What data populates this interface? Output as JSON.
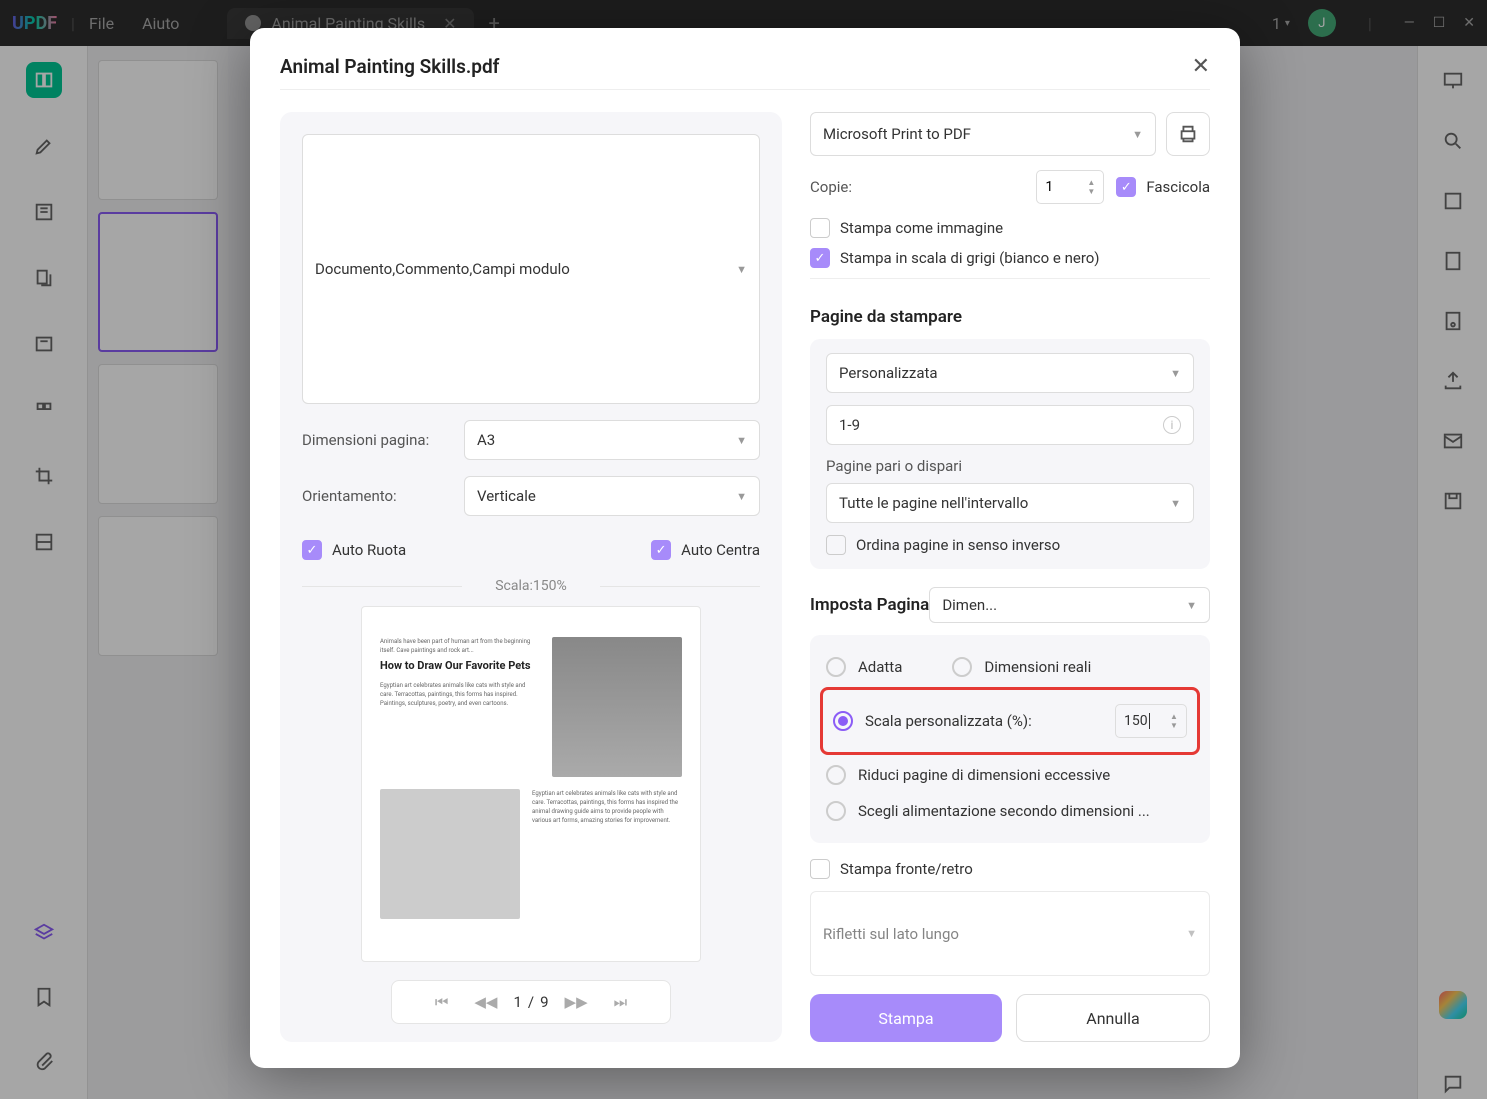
{
  "app": {
    "logo": "UPDF",
    "menus": [
      "File",
      "Aiuto"
    ],
    "tab_title": "Animal Painting Skills",
    "tab_count": "1",
    "avatar_letter": "J"
  },
  "dialog": {
    "title": "Animal Painting Skills.pdf",
    "content_type": "Documento,Commento,Campi modulo",
    "page_size_label": "Dimensioni pagina:",
    "page_size": "A3",
    "orientation_label": "Orientamento:",
    "orientation": "Verticale",
    "auto_rotate": "Auto Ruota",
    "auto_center": "Auto Centra",
    "scale_text": "Scala:150%",
    "preview_title": "How to Draw Our Favorite Pets",
    "pager": {
      "current": "1",
      "sep": "/",
      "total": "9"
    },
    "printer": "Microsoft Print to PDF",
    "copies_label": "Copie:",
    "copies": "1",
    "collate": "Fascicola",
    "print_as_image": "Stampa come immagine",
    "grayscale": "Stampa in scala di grigi (bianco e nero)",
    "pages_section": "Pagine da stampare",
    "range_mode": "Personalizzata",
    "range_value": "1-9",
    "odd_even_label": "Pagine pari o dispari",
    "odd_even": "Tutte le pagine nell'intervallo",
    "reverse": "Ordina pagine in senso inverso",
    "page_setup": "Imposta Pagina",
    "page_setup_mode": "Dimen...",
    "fit": "Adatta",
    "actual": "Dimensioni reali",
    "custom_scale_label": "Scala personalizzata (%):",
    "custom_scale_value": "150",
    "shrink": "Riduci pagine di dimensioni eccessive",
    "choose_paper": "Scegli alimentazione secondo dimensioni ...",
    "duplex": "Stampa fronte/retro",
    "flip": "Rifletti sul lato lungo",
    "print_btn": "Stampa",
    "cancel_btn": "Annulla"
  }
}
